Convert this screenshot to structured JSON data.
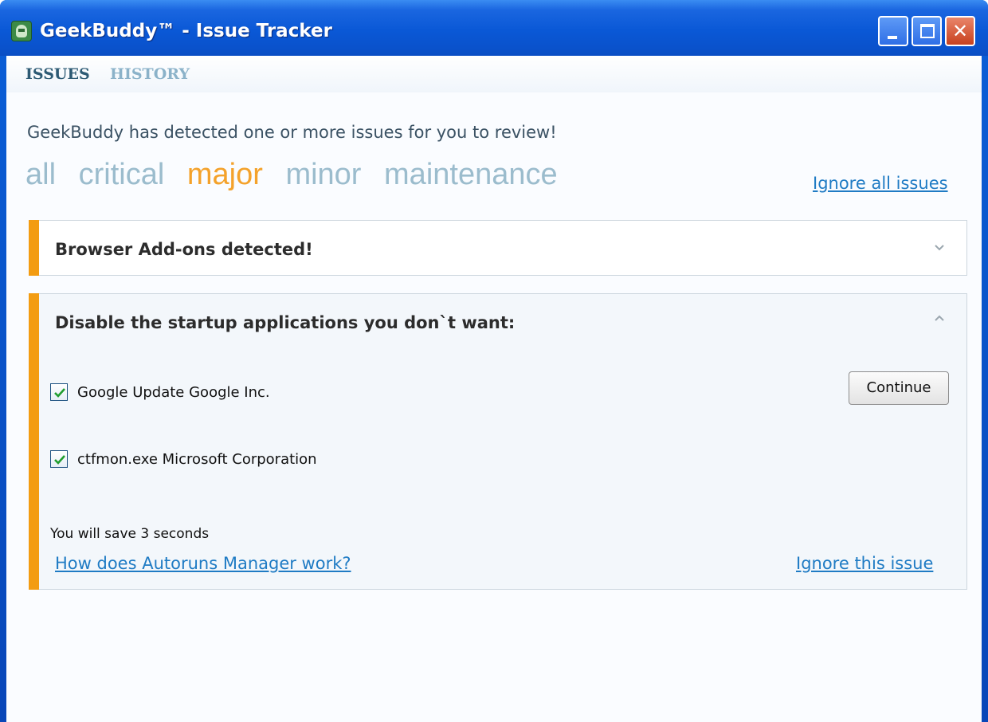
{
  "window": {
    "title": "GeekBuddy™ - Issue Tracker",
    "close_glyph": "✕"
  },
  "nav": {
    "issues": "ISSUES",
    "history": "HISTORY",
    "active": "issues"
  },
  "headline": "GeekBuddy has detected one or more issues for you to review!",
  "filters": {
    "items": [
      "all",
      "critical",
      "major",
      "minor",
      "maintenance"
    ],
    "active": "major",
    "active_color": "#f4a22b"
  },
  "ignore_all_label": "Ignore all issues",
  "issues": [
    {
      "title": "Browser Add-ons detected!",
      "expanded": false,
      "stripe_color": "#f39c12"
    },
    {
      "title": "Disable the startup applications you don`t want:",
      "expanded": true,
      "stripe_color": "#f39c12",
      "items": [
        {
          "label": "Google Update Google Inc.",
          "checked": true
        },
        {
          "label": "ctfmon.exe Microsoft Corporation",
          "checked": true
        }
      ],
      "continue_label": "Continue",
      "savings_text": "You will save 3 seconds",
      "help_link": "How does Autoruns Manager work?",
      "ignore_label": "Ignore this issue"
    }
  ],
  "icons": {
    "app": "geekbuddy-app-icon",
    "minimize": "minimize-icon",
    "maximize": "maximize-icon",
    "close": "close-icon",
    "collapsed": "chevron-down-icon",
    "expanded": "chevron-up-icon",
    "check": "checkmark-icon"
  }
}
